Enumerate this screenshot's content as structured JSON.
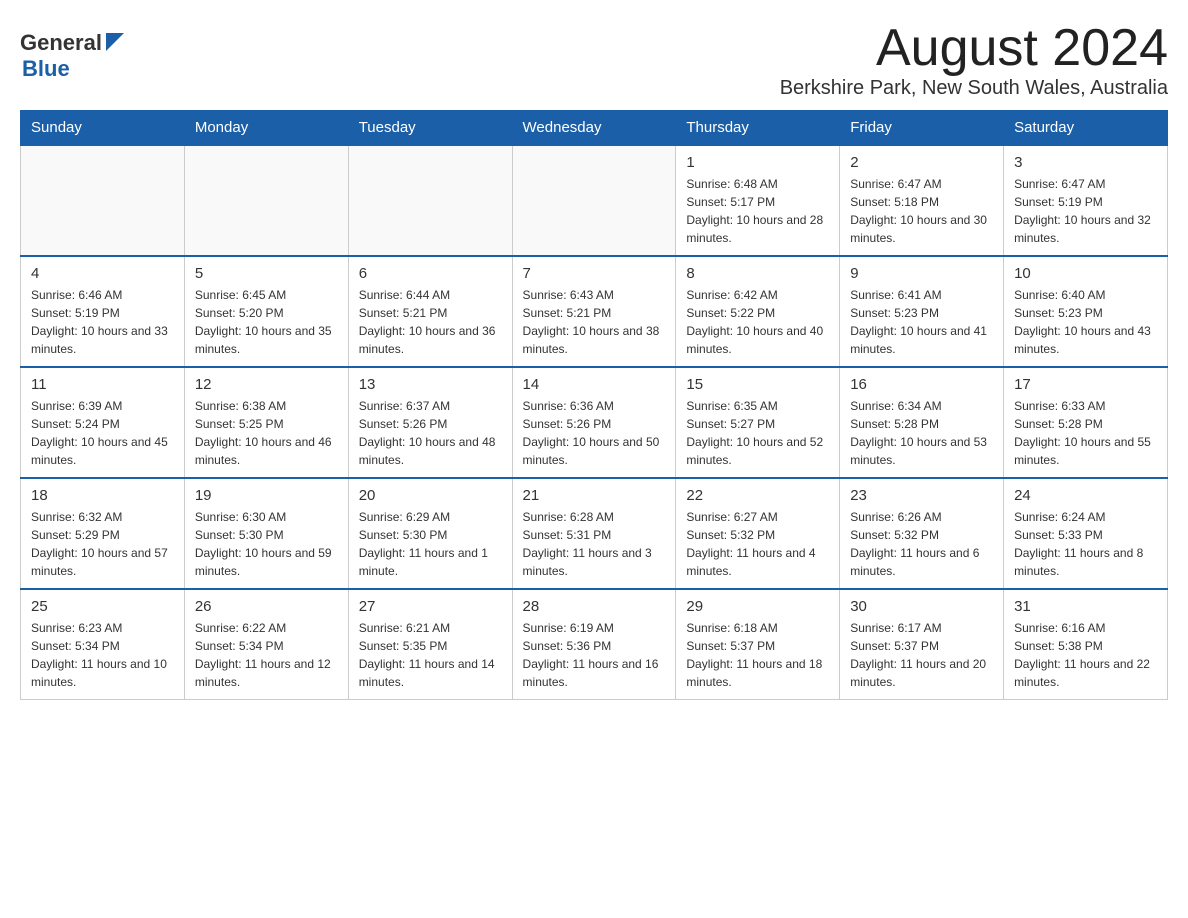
{
  "header": {
    "logo_general": "General",
    "logo_blue": "Blue",
    "month_title": "August 2024",
    "location": "Berkshire Park, New South Wales, Australia"
  },
  "days_of_week": [
    "Sunday",
    "Monday",
    "Tuesday",
    "Wednesday",
    "Thursday",
    "Friday",
    "Saturday"
  ],
  "weeks": [
    {
      "days": [
        {
          "number": "",
          "info": ""
        },
        {
          "number": "",
          "info": ""
        },
        {
          "number": "",
          "info": ""
        },
        {
          "number": "",
          "info": ""
        },
        {
          "number": "1",
          "info": "Sunrise: 6:48 AM\nSunset: 5:17 PM\nDaylight: 10 hours and 28 minutes."
        },
        {
          "number": "2",
          "info": "Sunrise: 6:47 AM\nSunset: 5:18 PM\nDaylight: 10 hours and 30 minutes."
        },
        {
          "number": "3",
          "info": "Sunrise: 6:47 AM\nSunset: 5:19 PM\nDaylight: 10 hours and 32 minutes."
        }
      ]
    },
    {
      "days": [
        {
          "number": "4",
          "info": "Sunrise: 6:46 AM\nSunset: 5:19 PM\nDaylight: 10 hours and 33 minutes."
        },
        {
          "number": "5",
          "info": "Sunrise: 6:45 AM\nSunset: 5:20 PM\nDaylight: 10 hours and 35 minutes."
        },
        {
          "number": "6",
          "info": "Sunrise: 6:44 AM\nSunset: 5:21 PM\nDaylight: 10 hours and 36 minutes."
        },
        {
          "number": "7",
          "info": "Sunrise: 6:43 AM\nSunset: 5:21 PM\nDaylight: 10 hours and 38 minutes."
        },
        {
          "number": "8",
          "info": "Sunrise: 6:42 AM\nSunset: 5:22 PM\nDaylight: 10 hours and 40 minutes."
        },
        {
          "number": "9",
          "info": "Sunrise: 6:41 AM\nSunset: 5:23 PM\nDaylight: 10 hours and 41 minutes."
        },
        {
          "number": "10",
          "info": "Sunrise: 6:40 AM\nSunset: 5:23 PM\nDaylight: 10 hours and 43 minutes."
        }
      ]
    },
    {
      "days": [
        {
          "number": "11",
          "info": "Sunrise: 6:39 AM\nSunset: 5:24 PM\nDaylight: 10 hours and 45 minutes."
        },
        {
          "number": "12",
          "info": "Sunrise: 6:38 AM\nSunset: 5:25 PM\nDaylight: 10 hours and 46 minutes."
        },
        {
          "number": "13",
          "info": "Sunrise: 6:37 AM\nSunset: 5:26 PM\nDaylight: 10 hours and 48 minutes."
        },
        {
          "number": "14",
          "info": "Sunrise: 6:36 AM\nSunset: 5:26 PM\nDaylight: 10 hours and 50 minutes."
        },
        {
          "number": "15",
          "info": "Sunrise: 6:35 AM\nSunset: 5:27 PM\nDaylight: 10 hours and 52 minutes."
        },
        {
          "number": "16",
          "info": "Sunrise: 6:34 AM\nSunset: 5:28 PM\nDaylight: 10 hours and 53 minutes."
        },
        {
          "number": "17",
          "info": "Sunrise: 6:33 AM\nSunset: 5:28 PM\nDaylight: 10 hours and 55 minutes."
        }
      ]
    },
    {
      "days": [
        {
          "number": "18",
          "info": "Sunrise: 6:32 AM\nSunset: 5:29 PM\nDaylight: 10 hours and 57 minutes."
        },
        {
          "number": "19",
          "info": "Sunrise: 6:30 AM\nSunset: 5:30 PM\nDaylight: 10 hours and 59 minutes."
        },
        {
          "number": "20",
          "info": "Sunrise: 6:29 AM\nSunset: 5:30 PM\nDaylight: 11 hours and 1 minute."
        },
        {
          "number": "21",
          "info": "Sunrise: 6:28 AM\nSunset: 5:31 PM\nDaylight: 11 hours and 3 minutes."
        },
        {
          "number": "22",
          "info": "Sunrise: 6:27 AM\nSunset: 5:32 PM\nDaylight: 11 hours and 4 minutes."
        },
        {
          "number": "23",
          "info": "Sunrise: 6:26 AM\nSunset: 5:32 PM\nDaylight: 11 hours and 6 minutes."
        },
        {
          "number": "24",
          "info": "Sunrise: 6:24 AM\nSunset: 5:33 PM\nDaylight: 11 hours and 8 minutes."
        }
      ]
    },
    {
      "days": [
        {
          "number": "25",
          "info": "Sunrise: 6:23 AM\nSunset: 5:34 PM\nDaylight: 11 hours and 10 minutes."
        },
        {
          "number": "26",
          "info": "Sunrise: 6:22 AM\nSunset: 5:34 PM\nDaylight: 11 hours and 12 minutes."
        },
        {
          "number": "27",
          "info": "Sunrise: 6:21 AM\nSunset: 5:35 PM\nDaylight: 11 hours and 14 minutes."
        },
        {
          "number": "28",
          "info": "Sunrise: 6:19 AM\nSunset: 5:36 PM\nDaylight: 11 hours and 16 minutes."
        },
        {
          "number": "29",
          "info": "Sunrise: 6:18 AM\nSunset: 5:37 PM\nDaylight: 11 hours and 18 minutes."
        },
        {
          "number": "30",
          "info": "Sunrise: 6:17 AM\nSunset: 5:37 PM\nDaylight: 11 hours and 20 minutes."
        },
        {
          "number": "31",
          "info": "Sunrise: 6:16 AM\nSunset: 5:38 PM\nDaylight: 11 hours and 22 minutes."
        }
      ]
    }
  ]
}
